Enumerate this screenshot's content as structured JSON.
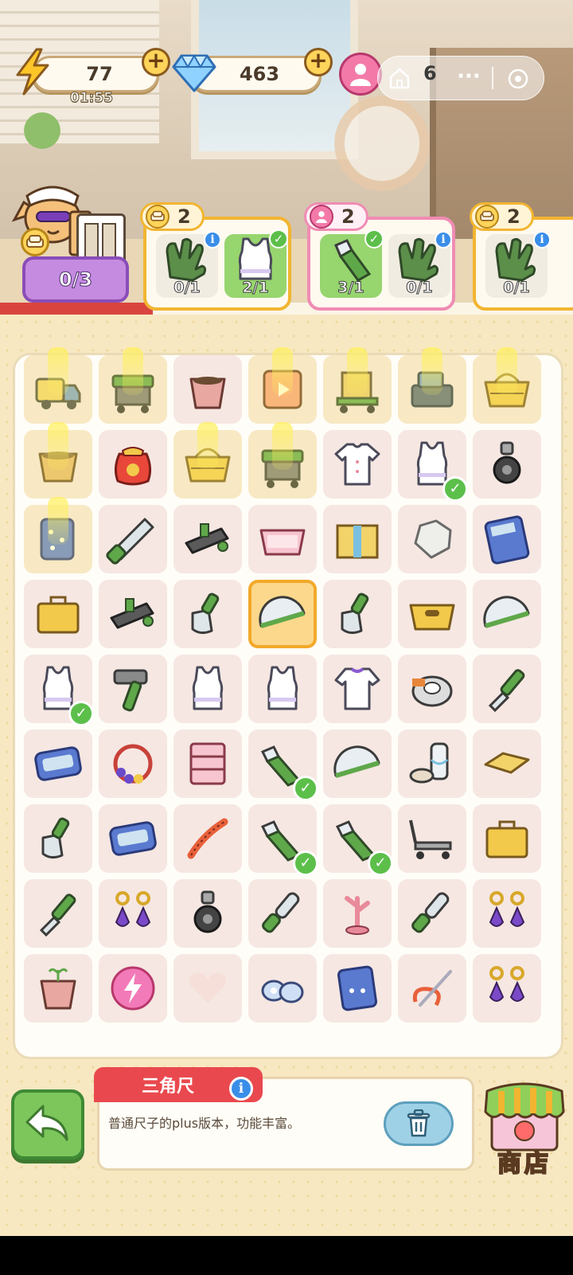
{
  "top_bar": {
    "energy": {
      "value": "77",
      "timer": "01:55",
      "icon": "lightning-bolt-icon"
    },
    "gems": {
      "value": "463",
      "icon": "diamond-icon"
    },
    "visitors": {
      "value": "6",
      "icon": "person-icon"
    },
    "capsule": {
      "home_icon": "home-icon",
      "more_icon": "more-dots-icon",
      "close_icon": "close-circle-icon"
    }
  },
  "customer": {
    "progress": "0/3",
    "icon": "sofa-icon"
  },
  "orders": [
    {
      "badge_type": "sofa-icon",
      "reward": "2",
      "slots": [
        {
          "item": "work-gloves",
          "count": "0/1",
          "done": false
        },
        {
          "item": "tank-top",
          "count": "2/1",
          "done": true
        }
      ]
    },
    {
      "badge_type": "person-icon",
      "reward": "2",
      "slots": [
        {
          "item": "utility-knife",
          "count": "3/1",
          "done": true
        },
        {
          "item": "work-gloves",
          "count": "0/1",
          "done": false
        }
      ]
    },
    {
      "badge_type": "sofa-icon",
      "reward": "2",
      "slots": [
        {
          "item": "work-gloves",
          "count": "0/1",
          "done": false
        }
      ]
    }
  ],
  "board": {
    "rows": [
      [
        "delivery-truck",
        "tool-cart",
        "plant-pot",
        "toy-box",
        "hand-truck",
        "cash-register",
        "shopping-basket"
      ],
      [
        "pot",
        "lucky-bag",
        "shopping-basket",
        "tool-cart",
        "shirt",
        "tank-top",
        "caster-wheel"
      ],
      [
        "fabric-roll",
        "hand-saw",
        "wood-plane",
        "plastic-basket",
        "cardboard-box",
        "crumpled-paper",
        "calculator"
      ],
      [
        "tool-box",
        "wood-plane",
        "putty-knife",
        "protractor",
        "putty-knife",
        "storage-basket",
        "protractor"
      ],
      [
        "tank-top",
        "hammer",
        "tank-top",
        "tank-top",
        "t-shirt",
        "tape-roll",
        "chisel"
      ],
      [
        "ice-tray",
        "bead-bracelet",
        "storage-rack",
        "utility-knife",
        "protractor",
        "glue-bottle",
        "flat-box"
      ],
      [
        "putty-knife",
        "ice-tray",
        "tape-measure",
        "utility-knife",
        "utility-knife",
        "platform-trolley",
        "tool-box"
      ],
      [
        "chisel",
        "earrings",
        "caster-wheel",
        "file-tool",
        "jewelry-stand",
        "file-tool",
        "earrings"
      ],
      [
        "seedling-pot",
        "energy-orb",
        "empty-heart",
        "washers",
        "remote-pad",
        "needle-thread",
        "earrings"
      ]
    ],
    "checked": [
      [
        1,
        5
      ],
      [
        4,
        0
      ],
      [
        5,
        3
      ],
      [
        6,
        3
      ],
      [
        6,
        4
      ]
    ],
    "locked": [
      [
        0,
        0
      ],
      [
        0,
        1
      ],
      [
        0,
        3
      ],
      [
        0,
        4
      ],
      [
        0,
        5
      ],
      [
        0,
        6
      ],
      [
        1,
        0
      ],
      [
        1,
        2
      ],
      [
        1,
        3
      ],
      [
        2,
        0
      ]
    ],
    "selected": [
      3,
      3
    ]
  },
  "item_panel": {
    "name": "三角尺",
    "description": "普通尺子的plus版本，功能丰富。",
    "delete_icon": "trash-icon"
  },
  "back_button": {
    "icon": "back-arrow-icon"
  },
  "shop": {
    "label": "商店",
    "icon": "shop-awning-icon"
  },
  "colors": {
    "accent_orange": "#f2b531",
    "accent_pink": "#f08cb4",
    "check_green": "#5cbf4a",
    "info_blue": "#3a8ee8",
    "tab_red": "#e9494e"
  }
}
